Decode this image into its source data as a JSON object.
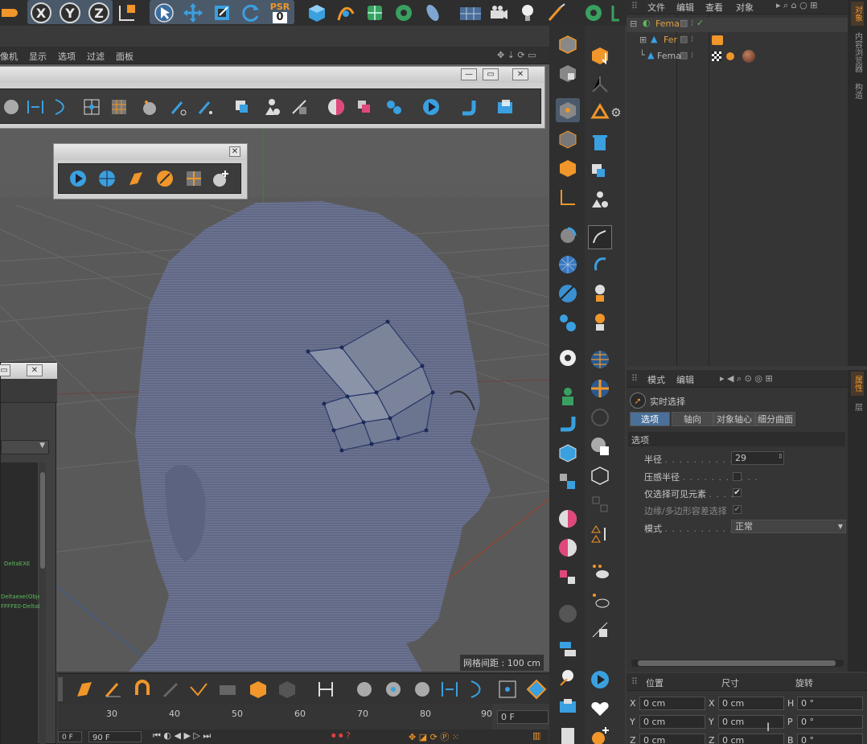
{
  "top_toolbar": {
    "axis_x": "X",
    "axis_y": "Y",
    "axis_z": "Z",
    "psr_label": "PSR",
    "psr_value": "0"
  },
  "viewport_menu": {
    "items": [
      "像机",
      "显示",
      "选项",
      "过滤",
      "面板"
    ]
  },
  "viewport": {
    "grid_spacing": "网格间距 : 100 cm"
  },
  "floating_palette_1": {
    "btn_minimize": "—",
    "btn_restore": "▭",
    "btn_close": "✕"
  },
  "floating_palette_2": {
    "btn_close": "✕"
  },
  "left_window": {
    "btn_restore": "▭",
    "btn_close": "✕",
    "log_lines": [
      "DeltaEXE",
      "Deltaexe(Obje",
      "FFFFE0-DeltaE"
    ]
  },
  "object_manager": {
    "menu": [
      "文件",
      "编辑",
      "查看",
      "对象"
    ],
    "rows": [
      {
        "name": "Fema",
        "color": "#e0a040"
      },
      {
        "name": "Fer",
        "color": "#e0a040"
      },
      {
        "name": "Fema",
        "color": "#b8b8b8"
      }
    ],
    "side_tabs": [
      "对象",
      "内容浏览器",
      "构造"
    ]
  },
  "attribute_manager": {
    "menu": [
      "模式",
      "编辑"
    ],
    "title": "实时选择",
    "tabs": [
      "选项",
      "轴向",
      "对象轴心",
      "细分曲面"
    ],
    "section": "选项",
    "rows": [
      {
        "label": "半径",
        "value": "29"
      },
      {
        "label": "压感半径",
        "checked": ""
      },
      {
        "label": "仅选择可见元素",
        "checked": "✔"
      },
      {
        "label": "边缘/多边形容差选择",
        "checked": "✔"
      },
      {
        "label": "模式",
        "value": "正常"
      }
    ],
    "side_tabs": [
      "属性",
      "层"
    ]
  },
  "coordinates": {
    "headers": [
      "位置",
      "尺寸",
      "旋转"
    ],
    "rows": [
      {
        "pos_axis": "X",
        "pos": "0 cm",
        "size_axis": "X",
        "size": "0 cm",
        "rot_axis": "H",
        "rot": "0 °"
      },
      {
        "pos_axis": "Y",
        "pos": "0 cm",
        "size_axis": "Y",
        "size": "0 cm",
        "rot_axis": "P",
        "rot": "0 °"
      },
      {
        "pos_axis": "Z",
        "pos": "0 cm",
        "size_axis": "Z",
        "size": "0 cm",
        "rot_axis": "B",
        "rot": "0 °"
      }
    ]
  },
  "timeline": {
    "ticks": [
      "30",
      "40",
      "50",
      "60",
      "70",
      "80",
      "90"
    ],
    "current_frame": "0 F",
    "start_frame": "0 F",
    "end_frame": "90 F"
  },
  "colors": {
    "accent_orange": "#f0962a",
    "accent_blue": "#3aa0e0",
    "panel_bg": "#353535"
  }
}
